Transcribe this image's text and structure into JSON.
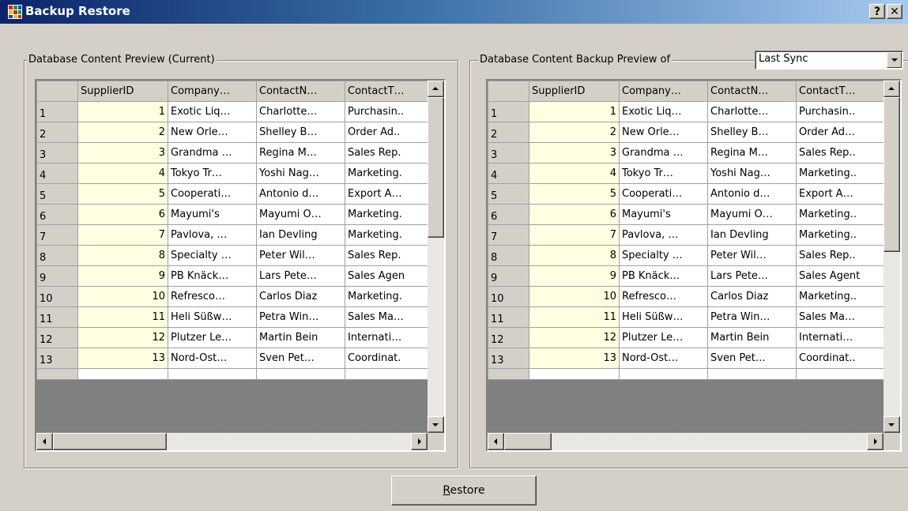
{
  "window": {
    "title": "Backup Restore",
    "help_label": "?",
    "close_label": "✕"
  },
  "current_panel": {
    "legend": "Database Content Preview (Current)"
  },
  "backup_panel": {
    "legend": "Database Content Backup Preview of",
    "selector_value": "Last Sync"
  },
  "grid": {
    "columns": [
      "SupplierID",
      "Company…",
      "ContactN…",
      "ContactT…"
    ],
    "rows_current": [
      {
        "n": "1",
        "id": "1",
        "company": "Exotic Liq…",
        "contact": "Charlotte…",
        "title": "Purchasin.."
      },
      {
        "n": "2",
        "id": "2",
        "company": "New Orle…",
        "contact": "Shelley B…",
        "title": "Order Ad.."
      },
      {
        "n": "3",
        "id": "3",
        "company": "Grandma …",
        "contact": "Regina M…",
        "title": "Sales Rep."
      },
      {
        "n": "4",
        "id": "4",
        "company": "Tokyo Tr…",
        "contact": "Yoshi Nag…",
        "title": "Marketing."
      },
      {
        "n": "5",
        "id": "5",
        "company": "Cooperati…",
        "contact": "Antonio d…",
        "title": "Export A…"
      },
      {
        "n": "6",
        "id": "6",
        "company": "Mayumi's",
        "contact": "Mayumi O…",
        "title": "Marketing."
      },
      {
        "n": "7",
        "id": "7",
        "company": "Pavlova, …",
        "contact": "Ian Devling",
        "title": "Marketing."
      },
      {
        "n": "8",
        "id": "8",
        "company": "Specialty …",
        "contact": "Peter Wil…",
        "title": "Sales Rep."
      },
      {
        "n": "9",
        "id": "9",
        "company": "PB Knäck…",
        "contact": "Lars Pete…",
        "title": "Sales Agen"
      },
      {
        "n": "10",
        "id": "10",
        "company": "Refresco…",
        "contact": "Carlos Diaz",
        "title": "Marketing."
      },
      {
        "n": "11",
        "id": "11",
        "company": "Heli Süßw…",
        "contact": "Petra Win…",
        "title": "Sales Ma…"
      },
      {
        "n": "12",
        "id": "12",
        "company": "Plutzer Le…",
        "contact": "Martin Bein",
        "title": "Internati…"
      },
      {
        "n": "13",
        "id": "13",
        "company": "Nord-Ost…",
        "contact": "Sven Pet…",
        "title": "Coordinat."
      }
    ],
    "rows_backup": [
      {
        "n": "1",
        "id": "1",
        "company": "Exotic Liq…",
        "contact": "Charlotte…",
        "title": "Purchasin.."
      },
      {
        "n": "2",
        "id": "2",
        "company": "New Orle…",
        "contact": "Shelley B…",
        "title": "Order Ad…"
      },
      {
        "n": "3",
        "id": "3",
        "company": "Grandma …",
        "contact": "Regina M…",
        "title": "Sales Rep.."
      },
      {
        "n": "4",
        "id": "4",
        "company": "Tokyo Tr…",
        "contact": "Yoshi Nag…",
        "title": "Marketing.."
      },
      {
        "n": "5",
        "id": "5",
        "company": "Cooperati…",
        "contact": "Antonio d…",
        "title": "Export A…"
      },
      {
        "n": "6",
        "id": "6",
        "company": "Mayumi's",
        "contact": "Mayumi O…",
        "title": "Marketing.."
      },
      {
        "n": "7",
        "id": "7",
        "company": "Pavlova, …",
        "contact": "Ian Devling",
        "title": "Marketing.."
      },
      {
        "n": "8",
        "id": "8",
        "company": "Specialty …",
        "contact": "Peter Wil…",
        "title": "Sales Rep.."
      },
      {
        "n": "9",
        "id": "9",
        "company": "PB Knäck…",
        "contact": "Lars Pete…",
        "title": "Sales Agent"
      },
      {
        "n": "10",
        "id": "10",
        "company": "Refresco…",
        "contact": "Carlos Diaz",
        "title": "Marketing.."
      },
      {
        "n": "11",
        "id": "11",
        "company": "Heli Süßw…",
        "contact": "Petra Win…",
        "title": "Sales Ma…"
      },
      {
        "n": "12",
        "id": "12",
        "company": "Plutzer Le…",
        "contact": "Martin Bein",
        "title": "Internati…"
      },
      {
        "n": "13",
        "id": "13",
        "company": "Nord-Ost…",
        "contact": "Sven Pet…",
        "title": "Coordinat.."
      }
    ]
  },
  "footer": {
    "restore_label": "Restore",
    "restore_accel": "R",
    "restore_rest": "estore"
  },
  "colors": {
    "titlebar_start": "#0a246a",
    "titlebar_end": "#a6caf0",
    "id_cell_bg": "#ffffe1",
    "face": "#d4d0c8"
  },
  "icons": [
    "app-grid-icon",
    "help-icon",
    "close-icon",
    "dropdown-arrow-icon",
    "scroll-up-icon",
    "scroll-down-icon",
    "scroll-left-icon",
    "scroll-right-icon"
  ]
}
